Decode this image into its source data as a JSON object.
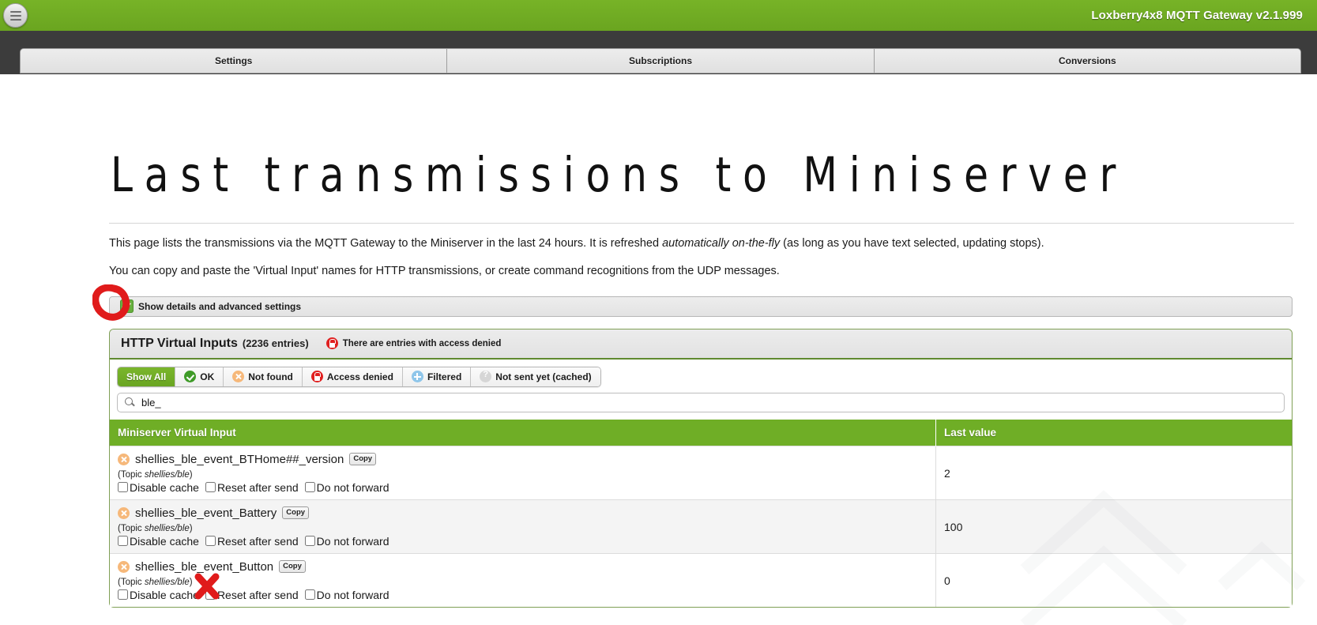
{
  "header": {
    "title": "Loxberry4x8 MQTT Gateway v2.1.999",
    "menu_icon": "hamburger-menu-icon"
  },
  "tabs": [
    {
      "label": "Settings"
    },
    {
      "label": "Subscriptions"
    },
    {
      "label": "Conversions"
    }
  ],
  "main": {
    "page_title": "Last transmissions to Miniserver",
    "paragraph1_part1": "This page lists the transmissions via the MQTT Gateway to the Miniserver in the last 24 hours. It is refreshed ",
    "paragraph1_em": "automatically on-the-fly",
    "paragraph1_part2": " (as long as you have text selected, updating stops).",
    "paragraph2": "You can copy and paste the 'Virtual Input' names for HTTP transmissions, or create command recognitions from the UDP messages.",
    "show_details_label": "Show details and advanced settings",
    "show_details_checked": true
  },
  "panel": {
    "title": "HTTP Virtual Inputs",
    "count": "(2236 entries)",
    "warning": "There are entries with access denied",
    "warning_icon": "lock-icon"
  },
  "filters": [
    {
      "label": "Show All",
      "icon": "none",
      "active": true
    },
    {
      "label": "OK",
      "icon": "ok-icon",
      "active": false
    },
    {
      "label": "Not found",
      "icon": "not-found-icon",
      "active": false
    },
    {
      "label": "Access denied",
      "icon": "lock-icon",
      "active": false
    },
    {
      "label": "Filtered",
      "icon": "filtered-icon",
      "active": false
    },
    {
      "label": "Not sent yet (cached)",
      "icon": "cached-icon",
      "active": false
    }
  ],
  "search": {
    "value": "ble_",
    "placeholder": "",
    "icon": "search-icon"
  },
  "table": {
    "columns": [
      "Miniserver Virtual Input",
      "Last value"
    ],
    "option_labels": [
      "Disable cache",
      "Reset after send",
      "Do not forward"
    ],
    "copy_label": "Copy",
    "topic_prefix": "(Topic ",
    "topic_suffix": ")",
    "rows": [
      {
        "status_icon": "not-found-icon",
        "name": "shellies_ble_event_BTHome##_version",
        "topic": "shellies/ble",
        "last_value": "2",
        "disable_cache": false,
        "reset_after_send": false,
        "do_not_forward": false
      },
      {
        "status_icon": "not-found-icon",
        "name": "shellies_ble_event_Battery",
        "topic": "shellies/ble",
        "last_value": "100",
        "disable_cache": false,
        "reset_after_send": false,
        "do_not_forward": false
      },
      {
        "status_icon": "not-found-icon",
        "name": "shellies_ble_event_Button",
        "topic": "shellies/ble",
        "last_value": "0",
        "disable_cache": false,
        "reset_after_send": false,
        "do_not_forward": false
      }
    ]
  },
  "annotations": {
    "circle_color": "#e01b1b",
    "x_color": "#e01b1b",
    "circle_target": "show-details-checkbox",
    "x_target": "disable-cache-checkbox-row3"
  }
}
